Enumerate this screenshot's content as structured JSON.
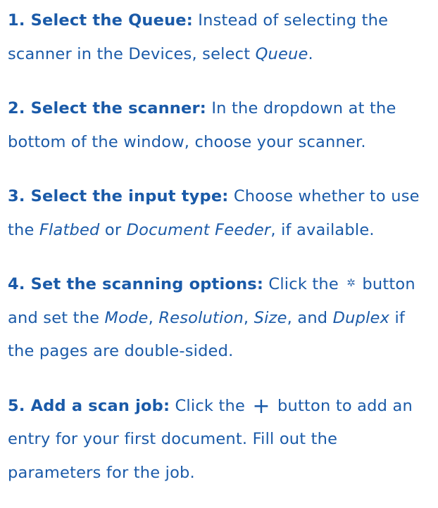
{
  "steps": [
    {
      "title": "1. Select the Queue:",
      "parts": [
        {
          "text": " Instead of selecting the scanner in the Devices, select "
        },
        {
          "text": "Queue",
          "em": true
        },
        {
          "text": "."
        }
      ]
    },
    {
      "title": "2. Select the scanner:",
      "parts": [
        {
          "text": " In the dropdown at the bottom of the window, choose your scanner."
        }
      ]
    },
    {
      "title": "3. Select the input type:",
      "parts": [
        {
          "text": " Choose whether to use the "
        },
        {
          "text": "Flatbed",
          "em": true
        },
        {
          "text": " or "
        },
        {
          "text": "Document Feeder",
          "em": true
        },
        {
          "text": ", if available."
        }
      ]
    },
    {
      "title": "4. Set the scanning options:",
      "parts": [
        {
          "text": " Click the "
        },
        {
          "icon": "gear-icon"
        },
        {
          "text": " button and set the "
        },
        {
          "text": "Mode",
          "em": true
        },
        {
          "text": ", "
        },
        {
          "text": "Resolution",
          "em": true
        },
        {
          "text": ", "
        },
        {
          "text": "Size",
          "em": true
        },
        {
          "text": ", and "
        },
        {
          "text": "Duplex",
          "em": true
        },
        {
          "text": " if the pages are double-sided."
        }
      ]
    },
    {
      "title": "5. Add a scan job:",
      "parts": [
        {
          "text": " Click the "
        },
        {
          "icon": "plus-icon"
        },
        {
          "text": " button to add an entry for your first document. Fill out the parameters for the job."
        }
      ]
    }
  ],
  "colors": {
    "text": "#1a5aa8",
    "background": "#ffffff"
  }
}
